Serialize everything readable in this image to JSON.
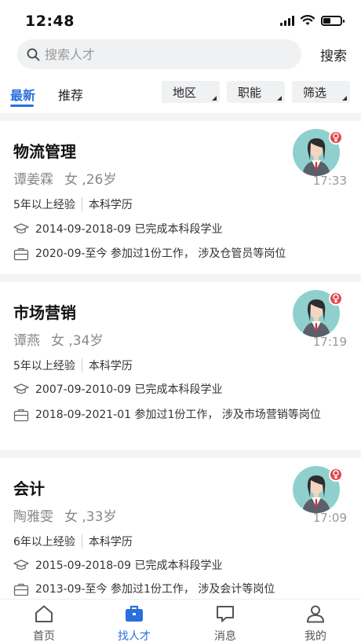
{
  "status_bar": {
    "time": "12:48",
    "battery_level": 0.45
  },
  "search": {
    "placeholder": "搜索人才",
    "button_label": "搜索"
  },
  "tabs": [
    {
      "label": "最新",
      "active": true
    },
    {
      "label": "推荐",
      "active": false
    }
  ],
  "filters": [
    {
      "label": "地区"
    },
    {
      "label": "职能"
    },
    {
      "label": "筛选"
    }
  ],
  "candidates": [
    {
      "title": "物流管理",
      "name": "谭姜霖",
      "sex_age": "女 ,26岁",
      "experience": "5年以上经验",
      "education": "本科学历",
      "education_history": "2014-09-2018-09 已完成本科段学业",
      "work_history": "2020-09-至今 参加过1份工作， 涉及仓管员等岗位",
      "time": "17:33"
    },
    {
      "title": "市场营销",
      "name": "谭燕",
      "sex_age": "女 ,34岁",
      "experience": "5年以上经验",
      "education": "本科学历",
      "education_history": "2007-09-2010-09 已完成本科段学业",
      "work_history": "2018-09-2021-01 参加过1份工作， 涉及市场营销等岗位",
      "time": "17:19"
    },
    {
      "title": "会计",
      "name": "陶雅雯",
      "sex_age": "女 ,33岁",
      "experience": "6年以上经验",
      "education": "本科学历",
      "education_history": "2015-09-2018-09 已完成本科段学业",
      "work_history": "2013-09-至今 参加过1份工作， 涉及会计等岗位",
      "time": "17:09"
    }
  ],
  "bottom_nav": [
    {
      "label": "首页",
      "icon": "home-icon",
      "active": false
    },
    {
      "label": "找人才",
      "icon": "briefcase-icon",
      "active": true
    },
    {
      "label": "消息",
      "icon": "message-icon",
      "active": false
    },
    {
      "label": "我的",
      "icon": "user-icon",
      "active": false
    }
  ],
  "colors": {
    "accent": "#2a6fdb",
    "badge": "#e24a4a"
  }
}
